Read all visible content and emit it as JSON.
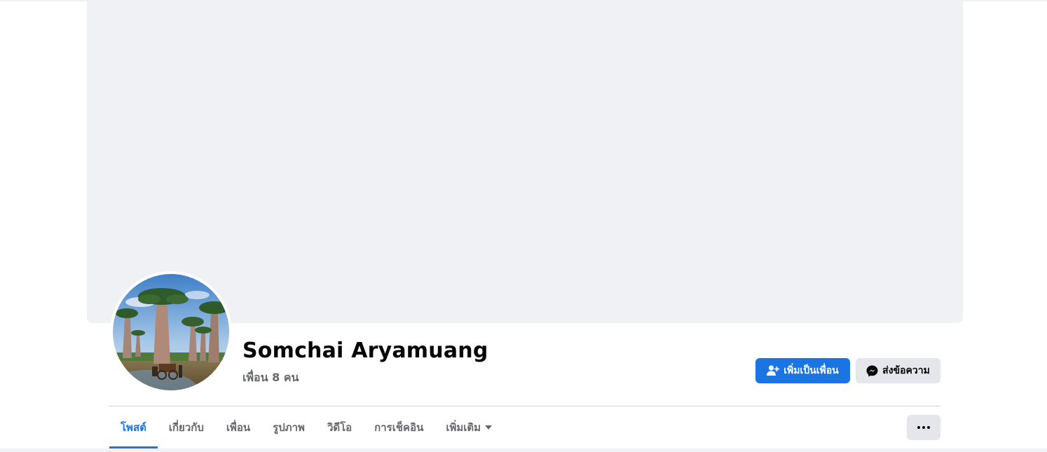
{
  "profile": {
    "name": "Somchai Aryamuang",
    "friends_text": "เพื่อน 8 คน",
    "avatar_description_icon": "baobab-photo"
  },
  "actions": {
    "add_friend_label": "เพิ่มเป็นเพื่อน",
    "add_friend_icon": "add-friend-icon",
    "message_label": "ส่งข้อความ",
    "message_icon": "messenger-icon",
    "more_icon": "more-dots-icon"
  },
  "tabs": [
    {
      "label": "โพสต์",
      "active": true
    },
    {
      "label": "เกี่ยวกับ",
      "active": false
    },
    {
      "label": "เพื่อน",
      "active": false
    },
    {
      "label": "รูปภาพ",
      "active": false
    },
    {
      "label": "วิดีโอ",
      "active": false
    },
    {
      "label": "การเช็คอิน",
      "active": false
    },
    {
      "label": "เพิ่มเติม",
      "active": false,
      "has_dropdown": true
    }
  ],
  "colors": {
    "accent": "#1b74e4",
    "cover_bg": "#f0f1f5",
    "secondary_button": "#e4e6eb",
    "muted_text": "#65676b"
  }
}
